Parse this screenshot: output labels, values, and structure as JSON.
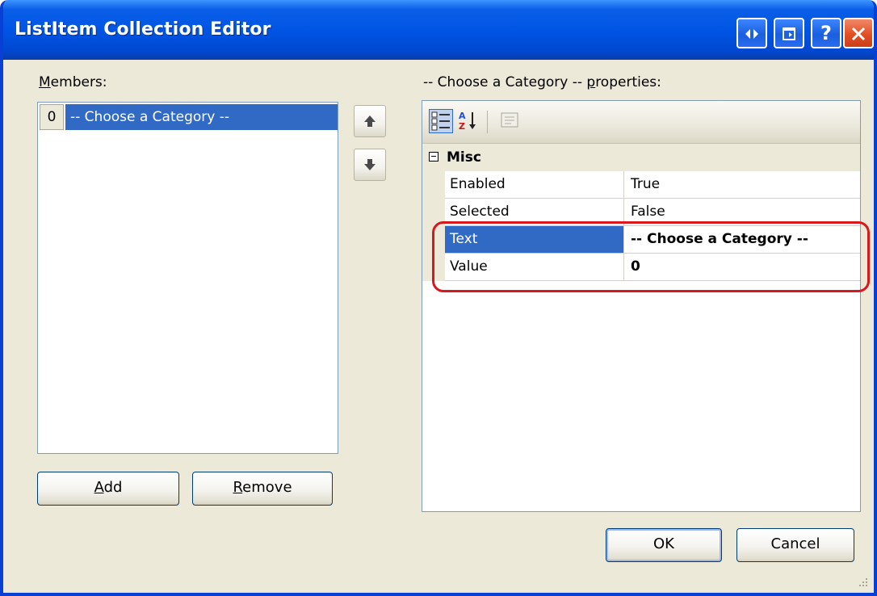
{
  "window": {
    "title": "ListItem Collection Editor"
  },
  "titlebar_buttons": {
    "restore_icon": "double-arrow-icon",
    "minimize_icon": "window-icon",
    "help_label": "?",
    "close_icon": "close-icon"
  },
  "members": {
    "label_prefix": "",
    "label_mnemonic": "M",
    "label_rest": "embers:",
    "items": [
      {
        "index": "0",
        "text": "-- Choose a Category --",
        "selected": true
      }
    ]
  },
  "move_buttons": {
    "up_icon": "up-arrow-icon",
    "down_icon": "down-arrow-icon"
  },
  "buttons": {
    "add_mnemonic": "A",
    "add_rest": "dd",
    "remove_mnemonic": "R",
    "remove_rest": "emove",
    "ok": "OK",
    "cancel": "Cancel"
  },
  "properties": {
    "header_prefix": "-- Choose a Category -- ",
    "header_mnemonic": "p",
    "header_rest": "roperties:",
    "toolbar_icons": [
      "categorized-icon",
      "alphabetical-icon",
      "property-pages-icon"
    ],
    "category": "Misc",
    "rows": [
      {
        "name": "Enabled",
        "value": "True",
        "bold": false,
        "selected": false
      },
      {
        "name": "Selected",
        "value": "False",
        "bold": false,
        "selected": false
      },
      {
        "name": "Text",
        "value": "-- Choose a Category --",
        "bold": true,
        "selected": true
      },
      {
        "name": "Value",
        "value": "0",
        "bold": true,
        "selected": false
      }
    ]
  },
  "colors": {
    "titlebar": "#0055e5",
    "selection": "#316ac5",
    "dialog_bg": "#ece9d8",
    "highlight_outline": "#d8181c"
  }
}
